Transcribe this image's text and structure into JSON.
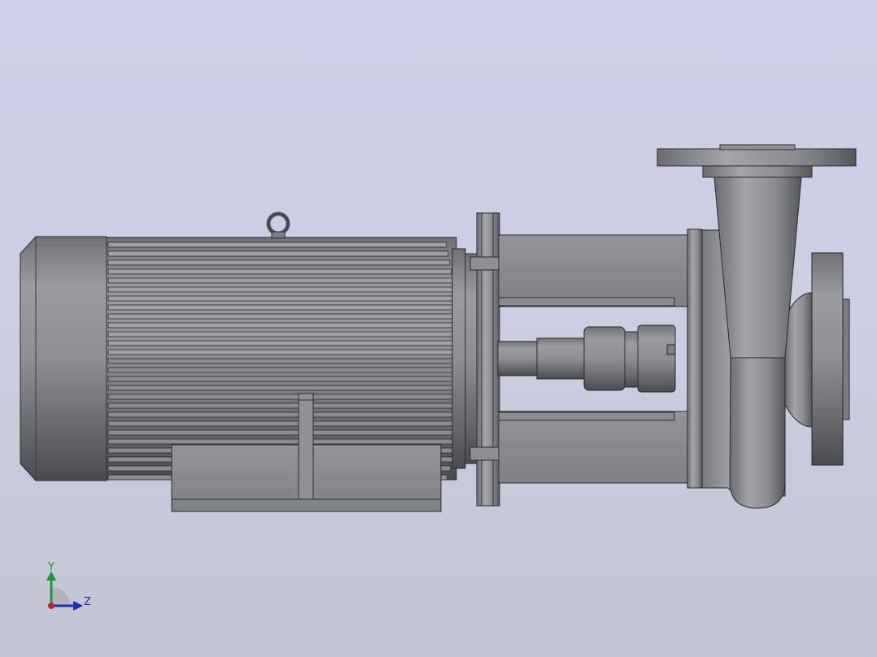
{
  "viewport": {
    "background_top": "#cfd0e8",
    "background_bottom": "#c3c5d3"
  },
  "model": {
    "metal_color": "#8e9093",
    "edge_color": "#2a2b2d"
  },
  "triad": {
    "y_label": "Y",
    "z_label": "Z",
    "y_color": "#1a9a3a",
    "z_color": "#1b2fb5",
    "x_color": "#c0282a"
  }
}
